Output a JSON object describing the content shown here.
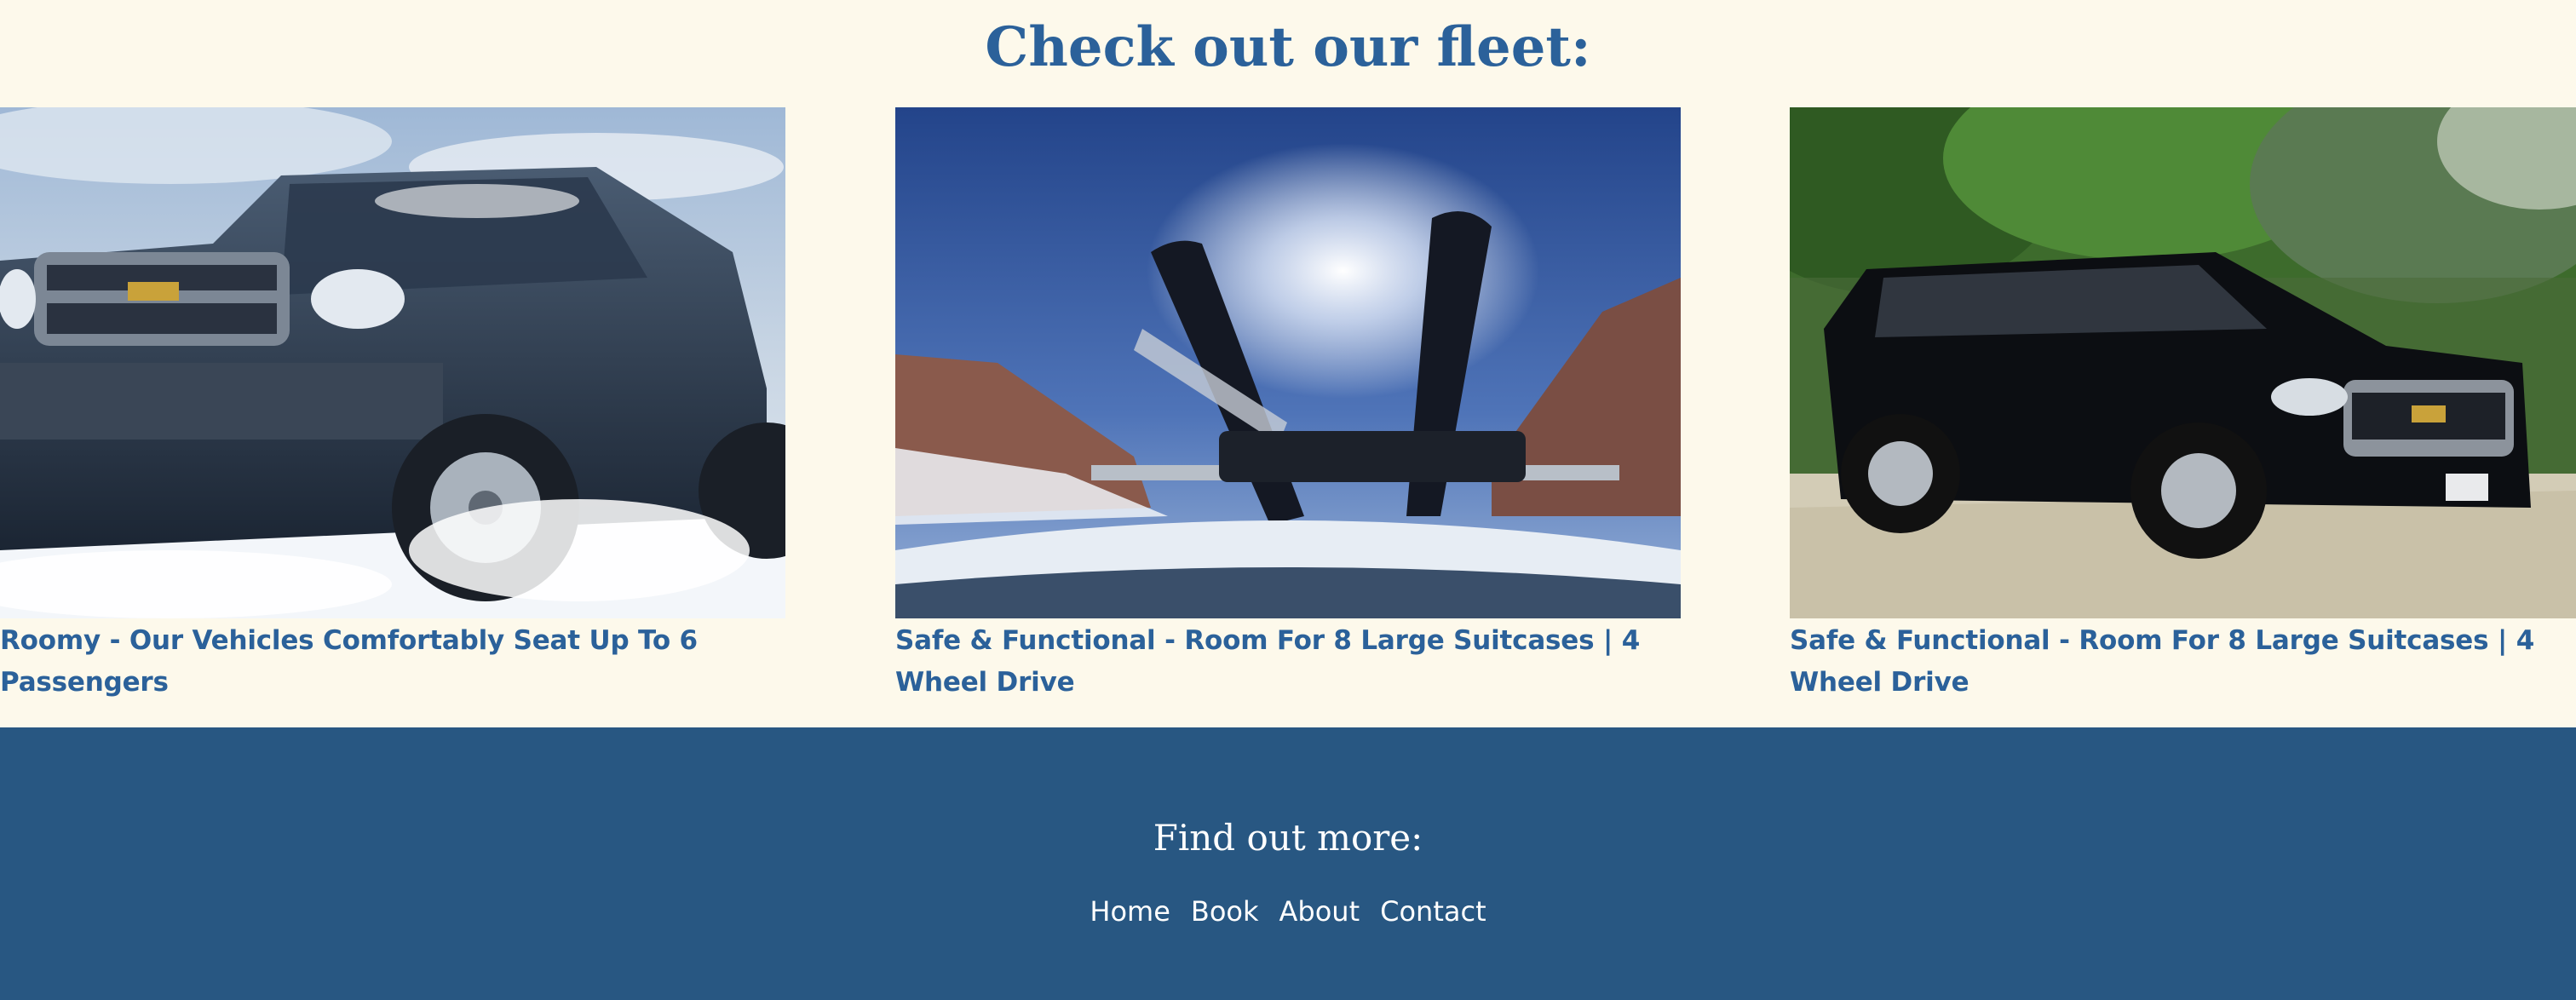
{
  "fleet": {
    "title": "Check out our fleet:",
    "cards": [
      {
        "image_icon": "snowy-chevy-suv-photo",
        "caption": "Roomy - Our Vehicles Comfortably Seat Up To 6 Passengers"
      },
      {
        "image_icon": "roof-ski-rack-photo",
        "caption": "Safe & Functional - Room For 8 Large Suitcases | 4 Wheel Drive"
      },
      {
        "image_icon": "black-suburban-photo",
        "caption": "Safe & Functional - Room For 8 Large Suitcases | 4 Wheel Drive"
      }
    ]
  },
  "footer": {
    "title": "Find out more:",
    "links": [
      "Home",
      "Book",
      "About",
      "Contact"
    ]
  },
  "colors": {
    "page_background": "#fdf9eb",
    "accent_text": "#2b619a",
    "footer_background": "#285782",
    "footer_text": "#ffffff"
  }
}
